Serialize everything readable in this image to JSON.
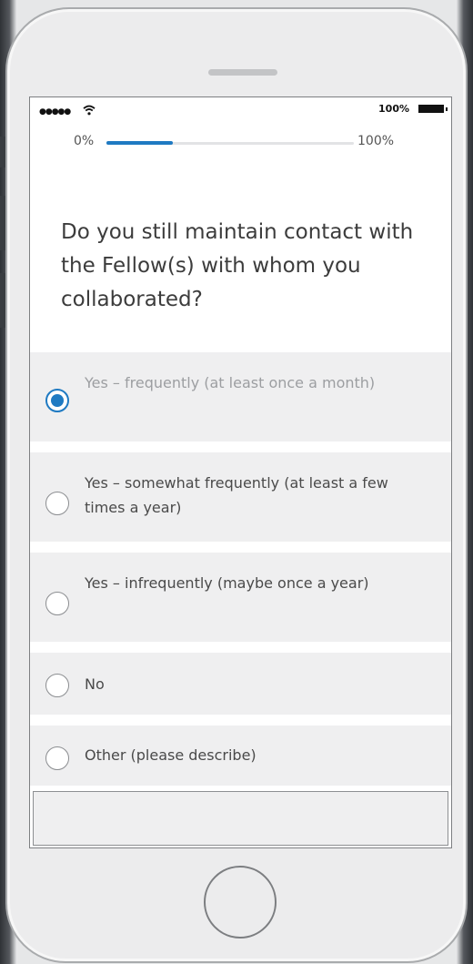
{
  "status_bar": {
    "signal_dots": "●●●●●",
    "wifi_icon": "wifi-icon",
    "battery_percent": "100%",
    "battery_icon": "battery-full-icon"
  },
  "progress": {
    "start_label": "0%",
    "end_label": "100%",
    "value_percent": 27,
    "fill_color": "#1f7ac2"
  },
  "question": {
    "text": "Do you still maintain contact with the Fellow(s) with whom you collaborated?"
  },
  "options": [
    {
      "label": "Yes – frequently (at least once a month)",
      "selected": true
    },
    {
      "label": "Yes – somewhat frequently (at least a few times a year)",
      "selected": false
    },
    {
      "label": "Yes – infrequently (maybe once a year)",
      "selected": false
    },
    {
      "label": "No",
      "selected": false
    },
    {
      "label": "Other (please describe)",
      "selected": false
    }
  ],
  "other_description": {
    "value": "",
    "placeholder": ""
  },
  "colors": {
    "accent": "#1f7ac2",
    "option_background": "#efeff0",
    "device_body": "#ececed"
  }
}
